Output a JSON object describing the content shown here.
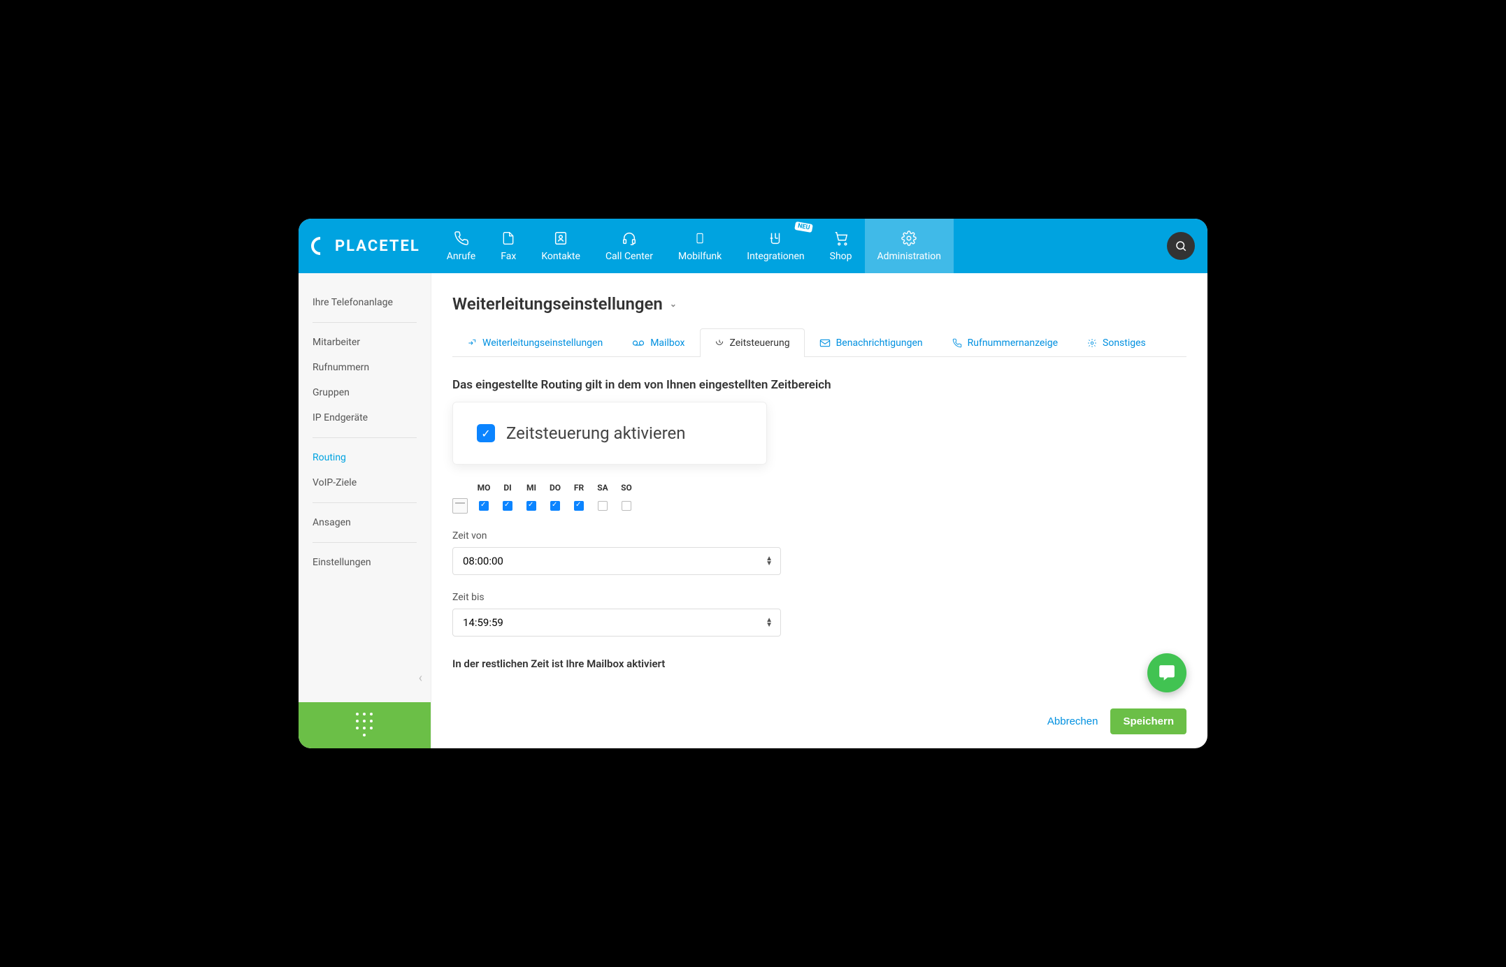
{
  "brand": "PLACETEL",
  "nav": [
    {
      "label": "Anrufe"
    },
    {
      "label": "Fax"
    },
    {
      "label": "Kontakte"
    },
    {
      "label": "Call Center"
    },
    {
      "label": "Mobilfunk"
    },
    {
      "label": "Integrationen",
      "badge": "NEU"
    },
    {
      "label": "Shop"
    },
    {
      "label": "Administration"
    }
  ],
  "sidebar": {
    "groups": [
      [
        "Ihre Telefonanlage"
      ],
      [
        "Mitarbeiter",
        "Rufnummern",
        "Gruppen",
        "IP Endgeräte"
      ],
      [
        "Routing",
        "VoIP-Ziele"
      ],
      [
        "Ansagen"
      ],
      [
        "Einstellungen"
      ]
    ],
    "active": "Routing"
  },
  "page": {
    "title": "Weiterleitungseinstellungen",
    "tabs": [
      "Weiterleitungseinstellungen",
      "Mailbox",
      "Zeitsteuerung",
      "Benachrichtigungen",
      "Rufnummernanzeige",
      "Sonstiges"
    ],
    "active_tab": "Zeitsteuerung",
    "section_heading": "Das eingestellte Routing gilt in dem von Ihnen eingestellten Zeitbereich",
    "activate_label": "Zeitsteuerung aktivieren",
    "activate_checked": true,
    "days": {
      "labels": [
        "MO",
        "DI",
        "MI",
        "DO",
        "FR",
        "SA",
        "SO"
      ],
      "checked": [
        true,
        true,
        true,
        true,
        true,
        false,
        false
      ]
    },
    "time_from_label": "Zeit von",
    "time_from_value": "08:00:00",
    "time_to_label": "Zeit bis",
    "time_to_value": "14:59:59",
    "note": "In der restlichen Zeit ist Ihre Mailbox aktiviert",
    "cancel": "Abbrechen",
    "save": "Speichern"
  }
}
